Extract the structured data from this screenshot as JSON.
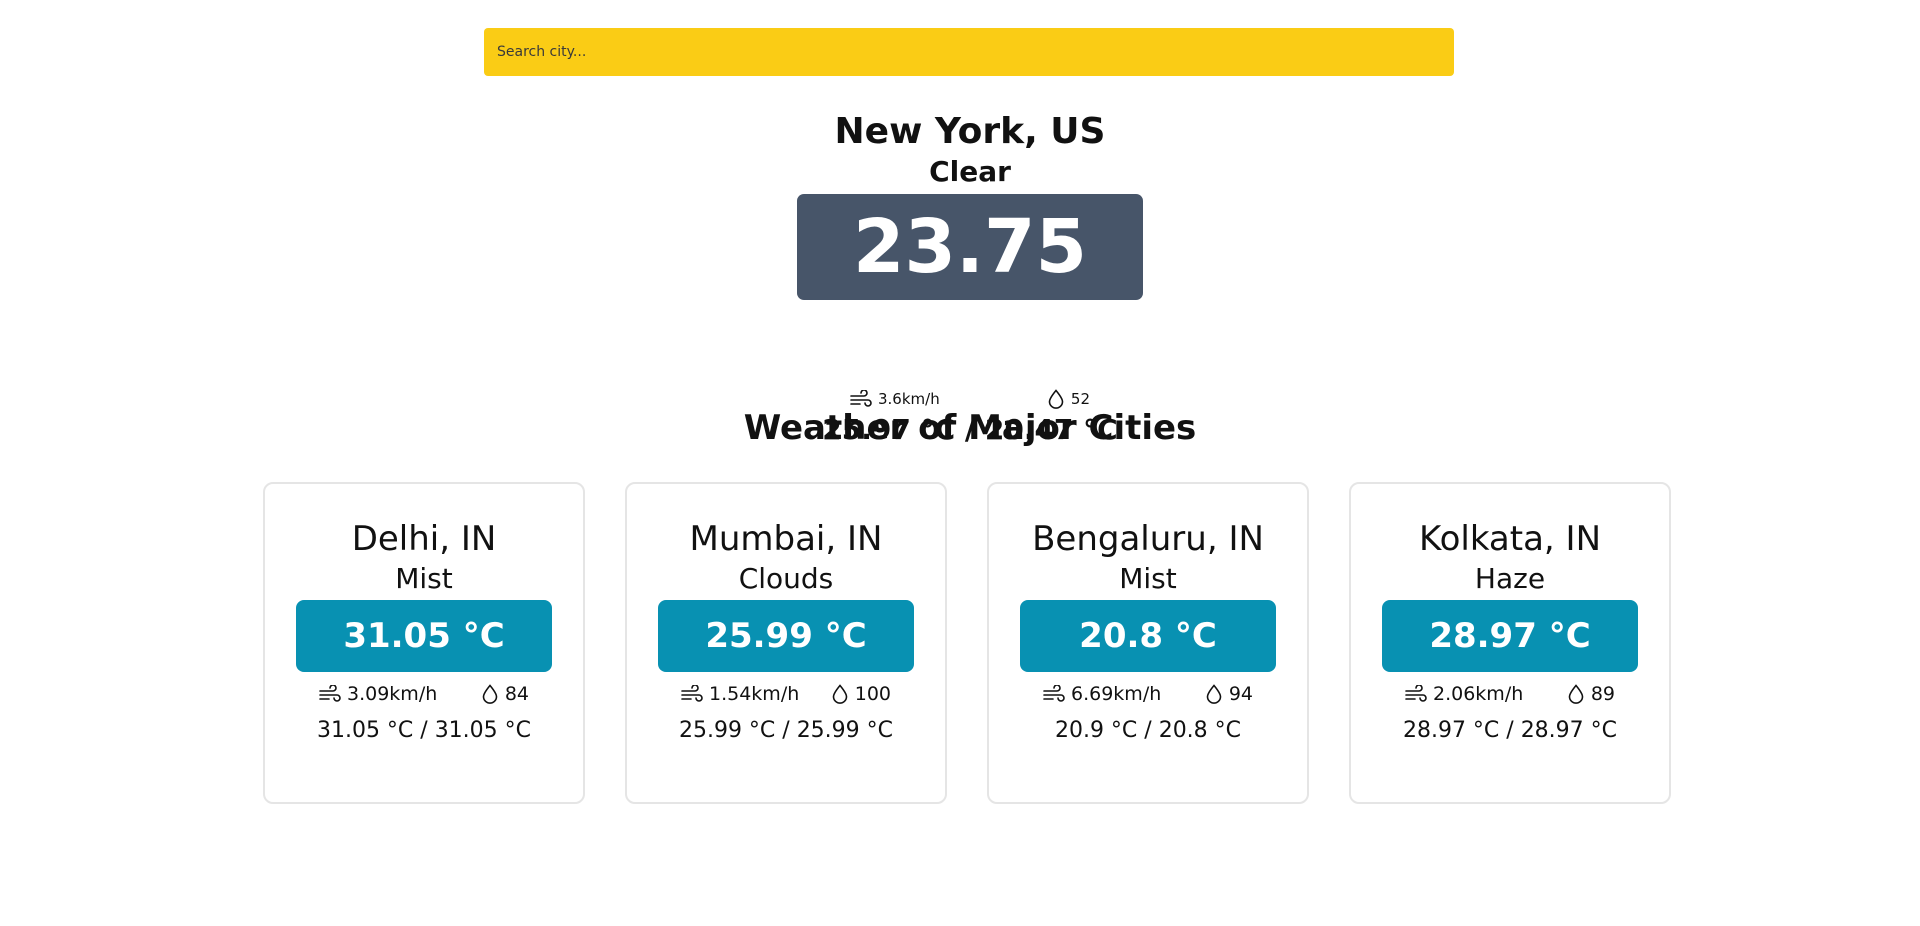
{
  "search": {
    "placeholder": "Search city..."
  },
  "current": {
    "city": "New York, US",
    "condition": "Clear",
    "temperature": "23.75 °C",
    "wind": "3.6km/h",
    "humidity": "52",
    "range": "25.97 °C / 20.47 °C"
  },
  "section_title": "Weather of Major Cities",
  "cities": [
    {
      "city": "Delhi, IN",
      "condition": "Mist",
      "temperature": "31.05 °C",
      "wind": "3.09km/h",
      "humidity": "84",
      "range": "31.05 °C / 31.05 °C"
    },
    {
      "city": "Mumbai, IN",
      "condition": "Clouds",
      "temperature": "25.99 °C",
      "wind": "1.54km/h",
      "humidity": "100",
      "range": "25.99 °C / 25.99 °C"
    },
    {
      "city": "Bengaluru, IN",
      "condition": "Mist",
      "temperature": "20.8 °C",
      "wind": "6.69km/h",
      "humidity": "94",
      "range": "20.9 °C / 20.8 °C"
    },
    {
      "city": "Kolkata, IN",
      "condition": "Haze",
      "temperature": "28.97 °C",
      "wind": "2.06km/h",
      "humidity": "89",
      "range": "28.97 °C / 28.97 °C"
    }
  ],
  "icons": {
    "wind": "wind-icon",
    "humidity": "droplet-icon"
  },
  "colors": {
    "search_bg": "#facc15",
    "current_temp_bg": "#475569",
    "card_temp_bg": "#0891b2"
  }
}
